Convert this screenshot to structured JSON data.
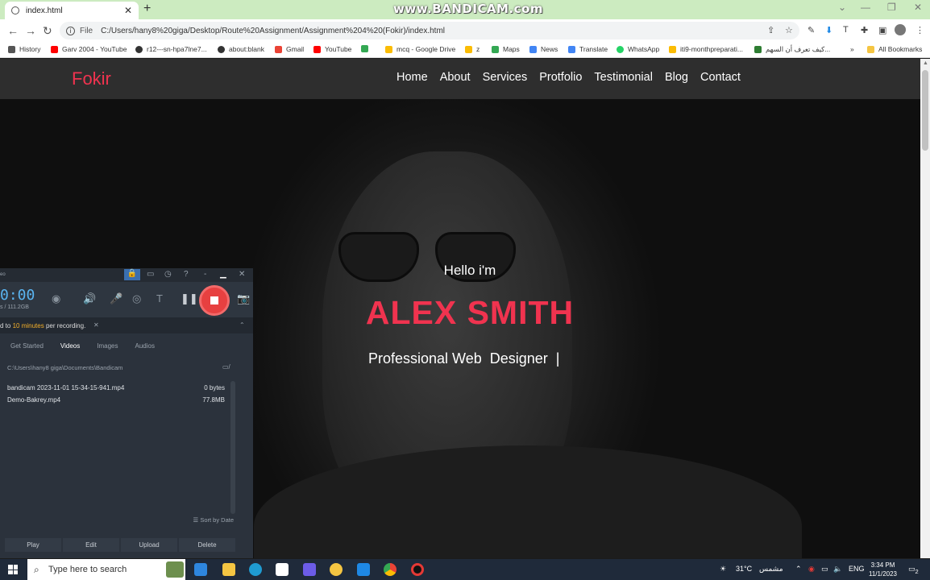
{
  "browser": {
    "tab_title": "index.html",
    "new_tab": "+",
    "watermark": "www.BANDICAM.com",
    "url_scheme": "File",
    "url": "C:/Users/hany8%20giga/Desktop/Route%20Assignment/Assignment%204%20(Fokir)/index.html",
    "bookmarks": [
      {
        "label": "History",
        "color": "#555555"
      },
      {
        "label": "Garv 2004 - YouTube",
        "color": "#ff0000"
      },
      {
        "label": "r12---sn-hpa7lne7...",
        "color": "#333333"
      },
      {
        "label": "about:blank",
        "color": "#333333"
      },
      {
        "label": "Gmail",
        "color": "#ea4335"
      },
      {
        "label": "YouTube",
        "color": "#ff0000"
      },
      {
        "label": "",
        "color": "#34a853"
      },
      {
        "label": "mcq - Google Drive",
        "color": "#fbbc04"
      },
      {
        "label": "z",
        "color": "#fbbc04"
      },
      {
        "label": "Maps",
        "color": "#34a853"
      },
      {
        "label": "News",
        "color": "#4285f4"
      },
      {
        "label": "Translate",
        "color": "#4285f4"
      },
      {
        "label": "WhatsApp",
        "color": "#25d366"
      },
      {
        "label": "iti9-monthpreparati...",
        "color": "#fbbc04"
      },
      {
        "label": "كيف تعرف أن السهم...",
        "color": "#2e7d32"
      }
    ],
    "more_bookmarks": "»",
    "all_bookmarks": "All Bookmarks"
  },
  "site": {
    "logo": "Fokir",
    "nav": [
      "Home",
      "About",
      "Services",
      "Protfolio",
      "Testimonial",
      "Blog",
      "Contact"
    ],
    "greeting": "Hello i'm",
    "name": "ALEX SMITH",
    "role": "Professional Web  Designer",
    "caret": "|",
    "accent_color": "#f0334f"
  },
  "bandicam": {
    "timer": "0:00",
    "size": "s / 111.2GB",
    "notice_prefix": "d to ",
    "notice_highlight": "10 minutes",
    "notice_suffix": " per recording.",
    "tabs": [
      "Get Started",
      "Videos",
      "Images",
      "Audios"
    ],
    "active_tab": "Videos",
    "path": "C:\\Users\\hany8 giga\\Documents\\Bandicam",
    "files": [
      {
        "name": "bandicam 2023-11-01 15-34-15-941.mp4",
        "size": "0 bytes"
      },
      {
        "name": "Demo-Bakrey.mp4",
        "size": "77.8MB"
      }
    ],
    "sort_label": "Sort by Date",
    "buttons": [
      "Play",
      "Edit",
      "Upload",
      "Delete"
    ],
    "top_label": "eo"
  },
  "taskbar": {
    "search_placeholder": "Type here to search",
    "weather_temp": "31°C",
    "weather_text": "مشمس",
    "language": "ENG",
    "time": "3:34 PM",
    "date": "11/1/2023",
    "notification_count": "2"
  }
}
